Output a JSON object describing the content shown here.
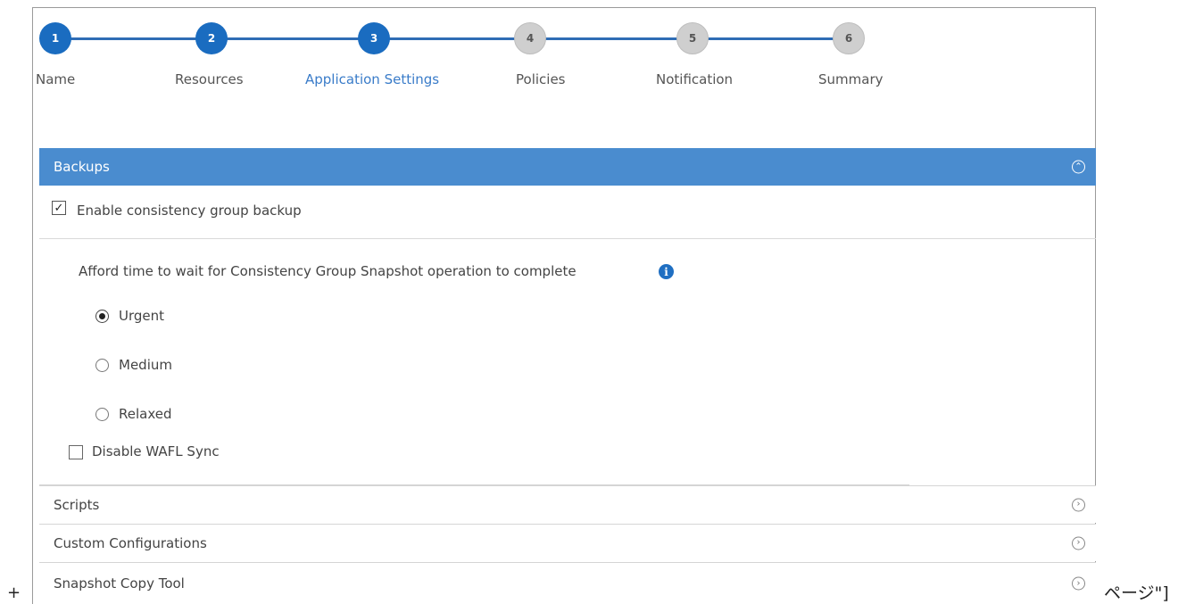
{
  "wizard": {
    "steps": [
      {
        "number": "1",
        "label": "Name"
      },
      {
        "number": "2",
        "label": "Resources"
      },
      {
        "number": "3",
        "label": "Application Settings"
      },
      {
        "number": "4",
        "label": "Policies"
      },
      {
        "number": "5",
        "label": "Notification"
      },
      {
        "number": "6",
        "label": "Summary"
      }
    ],
    "current_step": 3
  },
  "backups": {
    "title": "Backups",
    "chevron_icon": "chevron-up-circle-icon",
    "enable_cg_label": "Enable consistency group backup",
    "enable_cg_checked": true,
    "afford_text": "Afford time to wait for Consistency Group Snapshot operation to complete",
    "info_icon": "info-icon",
    "options": [
      {
        "label": "Urgent",
        "selected": true
      },
      {
        "label": "Medium",
        "selected": false
      },
      {
        "label": "Relaxed",
        "selected": false
      }
    ],
    "disable_wafl_label": "Disable WAFL Sync",
    "disable_wafl_checked": false
  },
  "sections": [
    {
      "title": "Scripts"
    },
    {
      "title": "Custom Configurations"
    },
    {
      "title": "Snapshot Copy Tool"
    }
  ],
  "outside": {
    "plus": "+",
    "trailing_text": "ページ\"]"
  },
  "colors": {
    "header_blue": "#4a8ccf",
    "step_active": "#1a6cc0",
    "step_inactive": "#cfcfcf",
    "current_label": "#3a7cc9"
  }
}
